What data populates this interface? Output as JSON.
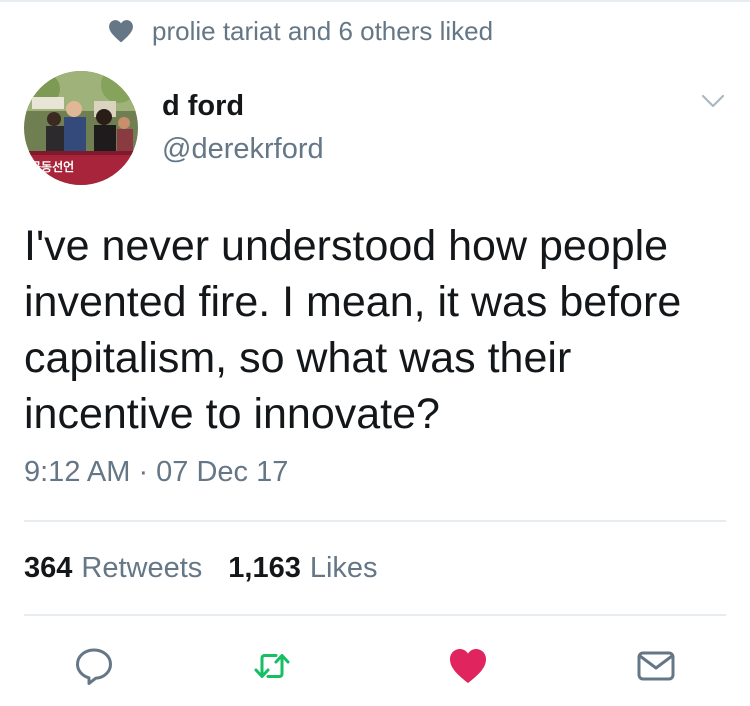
{
  "social_context": {
    "icon": "heart-icon",
    "text": "prolie tariat and 6 others liked"
  },
  "author": {
    "display_name": "d ford",
    "handle": "@derekrford",
    "avatar_banner_text": "공동선언"
  },
  "tweet": {
    "lines": [
      "I've never understood how people",
      "invented fire. I mean, it was before",
      "capitalism, so what was their",
      "incentive to innovate?"
    ],
    "timestamp": "9:12 AM · 07 Dec 17"
  },
  "stats": {
    "retweets_count": "364",
    "retweets_label": "Retweets",
    "likes_count": "1,163",
    "likes_label": "Likes"
  },
  "actions": [
    {
      "name": "reply",
      "icon": "reply-icon"
    },
    {
      "name": "retweet",
      "icon": "retweet-icon"
    },
    {
      "name": "like",
      "icon": "heart-icon",
      "active": true
    },
    {
      "name": "message",
      "icon": "envelope-icon"
    }
  ],
  "colors": {
    "text_primary": "#14171a",
    "text_secondary": "#657786",
    "divider": "#e6ecf0",
    "retweet_green": "#17bf63",
    "like_red": "#e0245e",
    "icon_gray": "#657786"
  }
}
